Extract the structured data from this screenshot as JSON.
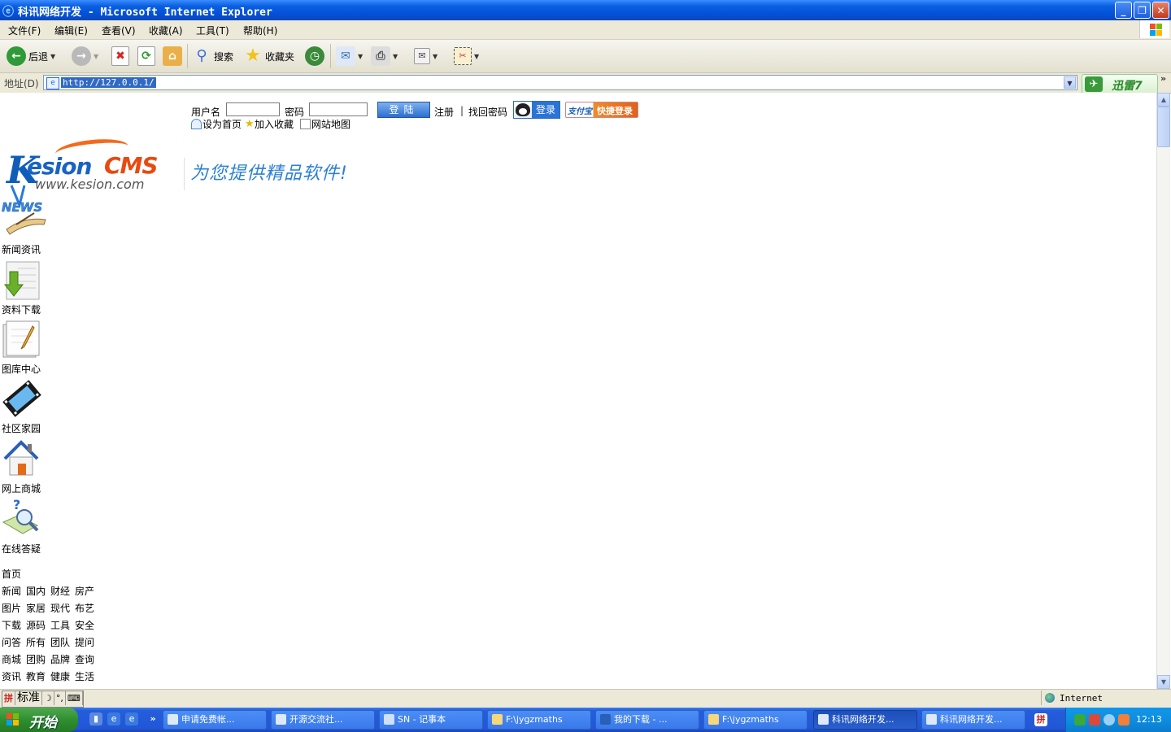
{
  "window": {
    "title": "科讯网络开发 - Microsoft Internet Explorer",
    "menu": [
      "文件(F)",
      "编辑(E)",
      "查看(V)",
      "收藏(A)",
      "工具(T)",
      "帮助(H)"
    ]
  },
  "toolbar": {
    "back_label": "后退",
    "search_label": "搜索",
    "favorites_label": "收藏夹"
  },
  "address": {
    "label": "地址(D)",
    "url": "http://127.0.0.1/",
    "xunlei_label": "迅雷7"
  },
  "page": {
    "login": {
      "username_label": "用户名",
      "password_label": "密码",
      "username_value": "",
      "password_value": "",
      "submit_label": "登陆",
      "register_label": "注册",
      "separator": "|",
      "forgot_label": "找回密码",
      "qq_login_label": "登录",
      "alipay_brand": "支付宝",
      "alipay_label": "快捷登录"
    },
    "top_links": [
      "设为首页",
      "加入收藏",
      "网站地图"
    ],
    "logo": {
      "k": "K",
      "esion": "esion",
      "cms": "CMS",
      "domain": "www.kesion.com"
    },
    "slogan": "为您提供精品软件!",
    "nav": [
      {
        "label": "新闻资讯",
        "icon": "news-icon"
      },
      {
        "label": "资料下载",
        "icon": "download-icon"
      },
      {
        "label": "图库中心",
        "icon": "gallery-icon"
      },
      {
        "label": "社区家园",
        "icon": "film-icon"
      },
      {
        "label": "网上商城",
        "icon": "home-icon"
      },
      {
        "label": "在线答疑",
        "icon": "search-question-icon"
      }
    ],
    "home_label": "首页",
    "categories": [
      [
        "新闻",
        "国内",
        "财经",
        "房产"
      ],
      [
        "图片",
        "家居",
        "现代",
        "布艺"
      ],
      [
        "下载",
        "源码",
        "工具",
        "安全"
      ],
      [
        "问答",
        "所有",
        "团队",
        "提问"
      ],
      [
        "商城",
        "团购",
        "品牌",
        "查询"
      ],
      [
        "资讯",
        "教育",
        "健康",
        "生活"
      ]
    ]
  },
  "statusbar": {
    "ime_mode": "标准",
    "zone": "Internet"
  },
  "taskbar": {
    "start_label": "开始",
    "tasks": [
      {
        "label": "申请免费帐...",
        "active": false
      },
      {
        "label": "开源交流社...",
        "active": false
      },
      {
        "label": "SN - 记事本",
        "active": false
      },
      {
        "label": "F:\\jygzmaths",
        "active": false
      },
      {
        "label": "我的下载 - ...",
        "active": false
      },
      {
        "label": "F:\\jygzmaths",
        "active": false
      },
      {
        "label": "科讯网络开发...",
        "active": true
      },
      {
        "label": "科讯网络开发...",
        "active": false
      }
    ],
    "clock": "12:13"
  },
  "colors": {
    "titlebar": "#0a5fe0",
    "taskbar": "#245ddb",
    "start": "#2f8f2f",
    "link_blue": "#2a7fd6",
    "logo_orange": "#e84a10"
  }
}
